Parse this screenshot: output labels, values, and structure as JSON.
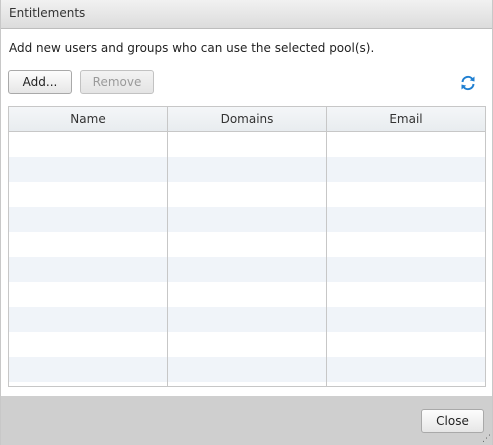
{
  "dialog": {
    "title": "Entitlements",
    "description": "Add new users and groups who can use the selected pool(s).",
    "toolbar": {
      "add_label": "Add...",
      "remove_label": "Remove",
      "refresh_icon": "refresh-icon"
    },
    "table": {
      "columns": [
        "Name",
        "Domains",
        "Email"
      ],
      "rows": []
    },
    "footer": {
      "close_label": "Close"
    },
    "colors": {
      "accent": "#1f7fd1",
      "alt_row": "#f0f4f9",
      "footer_bg": "#cfcfcf"
    }
  }
}
